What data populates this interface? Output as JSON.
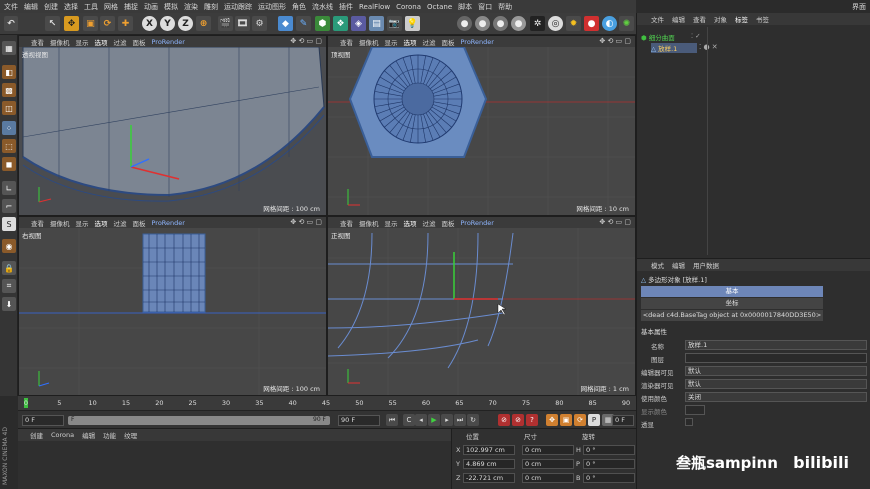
{
  "menubar": {
    "items": [
      "文件",
      "编辑",
      "创建",
      "选择",
      "工具",
      "网格",
      "捕捉",
      "动画",
      "模拟",
      "渲染",
      "雕刻",
      "运动跟踪",
      "运动图形",
      "角色",
      "流水线",
      "插件",
      "RealFlow",
      "Corona",
      "Octane",
      "脚本",
      "窗口",
      "帮助"
    ],
    "right": "界面"
  },
  "viewports": [
    {
      "menu": [
        "查看",
        "摄像机",
        "显示",
        "选项",
        "过滤",
        "面板",
        "ProRender"
      ],
      "title": "透视视图",
      "grid": "网格间距 : 100 cm"
    },
    {
      "menu": [
        "查看",
        "摄像机",
        "显示",
        "选项",
        "过滤",
        "面板",
        "ProRender"
      ],
      "title": "顶视图",
      "grid": "网格间距 : 10 cm"
    },
    {
      "menu": [
        "查看",
        "摄像机",
        "显示",
        "选项",
        "过滤",
        "面板",
        "ProRender"
      ],
      "title": "右视图",
      "grid": "网格间距 : 100 cm"
    },
    {
      "menu": [
        "查看",
        "摄像机",
        "显示",
        "选项",
        "过滤",
        "面板",
        "ProRender"
      ],
      "title": "正视图",
      "grid": "网格间距 : 1 cm"
    }
  ],
  "timeline": {
    "ticks": [
      "0",
      "5",
      "10",
      "15",
      "20",
      "25",
      "30",
      "35",
      "40",
      "45",
      "50",
      "55",
      "60",
      "65",
      "70",
      "75",
      "80",
      "85",
      "90"
    ],
    "current_frame": "0 F",
    "start": "0 F",
    "end_field": "90 F",
    "end_short": "90 F",
    "fps_field": "0 F",
    "playhead_marker": "F"
  },
  "material_panel": {
    "menu": [
      "创建",
      "Corona",
      "编辑",
      "功能",
      "纹理"
    ]
  },
  "coord_panel": {
    "headers": [
      "位置",
      "尺寸",
      "旋转"
    ],
    "rows": [
      {
        "axis": "X",
        "pos": "102.997 cm",
        "size": "0 cm",
        "rot_label": "H",
        "rot": "0 °"
      },
      {
        "axis": "Y",
        "pos": "4.869 cm",
        "size": "0 cm",
        "rot_label": "P",
        "rot": "0 °"
      },
      {
        "axis": "Z",
        "pos": "-22.721 cm",
        "size": "0 cm",
        "rot_label": "B",
        "rot": "0 °"
      }
    ]
  },
  "object_panel": {
    "tabs": [
      "文件",
      "编辑",
      "查看",
      "对象",
      "标签",
      "书签"
    ],
    "items": [
      {
        "name": "细分曲面"
      },
      {
        "name": "放样.1"
      }
    ]
  },
  "attr_panel": {
    "tabs": [
      "模式",
      "编辑",
      "用户数据"
    ],
    "object_line": "多边形对象 [放样.1]",
    "basic_tab": "基本",
    "coord_tab": "坐标",
    "tag_line": "<dead c4d.BaseTag object at 0x0000017840DD3E50>",
    "section": "基本属性",
    "fields": [
      {
        "label": "名称",
        "value": "放样.1"
      },
      {
        "label": "图层",
        "value": ""
      },
      {
        "label": "编辑器可见",
        "value": "默认"
      },
      {
        "label": "渲染器可见",
        "value": "默认"
      },
      {
        "label": "使用颜色",
        "value": "关闭"
      },
      {
        "label": "显示颜色",
        "value": ""
      },
      {
        "label": "透显",
        "value": ""
      }
    ]
  },
  "side_strip": "MAXON CINEMA 4D",
  "watermark": {
    "text": "叁瓶sampinn",
    "logo": "bilibili"
  }
}
